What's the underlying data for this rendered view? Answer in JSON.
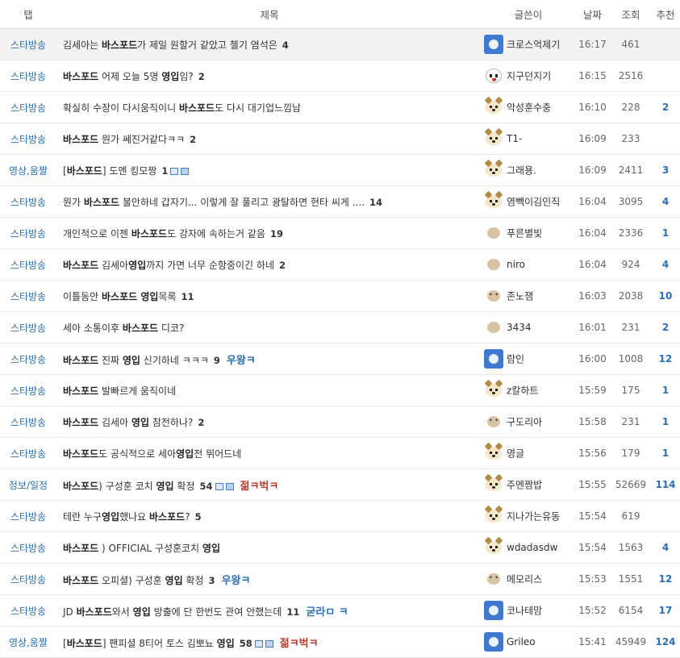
{
  "header": {
    "tab": "탭",
    "title": "제목",
    "writer": "글쓴이",
    "date": "날짜",
    "views": "조회",
    "recommend": "추천"
  },
  "rows": [
    {
      "tab": "스타방송",
      "title": [
        {
          "t": "김세아는 "
        },
        {
          "t": "바스포드",
          "b": true
        },
        {
          "t": "가 제일 원할거 같았고 첼기 염석은"
        }
      ],
      "comments": "4",
      "writer": "크로스억제기",
      "avatar": "blue",
      "date": "16:17",
      "views": "461",
      "rec": ""
    },
    {
      "tab": "스타방송",
      "title": [
        {
          "t": "바스포드",
          "b": true
        },
        {
          "t": " 어제 오늘 5명 "
        },
        {
          "t": "영입",
          "b": true
        },
        {
          "t": "임?"
        }
      ],
      "comments": "2",
      "writer": "지구던지기",
      "avatar": "panda",
      "date": "16:15",
      "views": "2516",
      "rec": ""
    },
    {
      "tab": "스타방송",
      "title": [
        {
          "t": "확실히 수장이 다시움직이니 "
        },
        {
          "t": "바스포드",
          "b": true
        },
        {
          "t": "도 다시 대기업느낌남"
        }
      ],
      "comments": "",
      "writer": "악성훈수충",
      "avatar": "dog",
      "date": "16:10",
      "views": "228",
      "rec": "2"
    },
    {
      "tab": "스타방송",
      "title": [
        {
          "t": "바스포드",
          "b": true
        },
        {
          "t": " 뭔가 쎄진거같다ㅋㅋ"
        }
      ],
      "comments": "2",
      "writer": "T1-",
      "avatar": "dog",
      "date": "16:09",
      "views": "233",
      "rec": ""
    },
    {
      "tab": "영상,움짤",
      "title": [
        {
          "t": "["
        },
        {
          "t": "바스포드",
          "b": true
        },
        {
          "t": "] 도멘 킹모짱"
        }
      ],
      "comments": "1",
      "attach": true,
      "writer": "그래용.",
      "avatar": "dog",
      "date": "16:09",
      "views": "2411",
      "rec": "3"
    },
    {
      "tab": "스타방송",
      "title": [
        {
          "t": "뭔가 "
        },
        {
          "t": "바스포드",
          "b": true
        },
        {
          "t": " 불안하네 갑자기... 이렇게 잘 풀리고 광탈하면 현타 씨게 ...."
        }
      ],
      "comments": "14",
      "writer": "염빽이김인직",
      "avatar": "dog",
      "date": "16:04",
      "views": "3095",
      "rec": "4"
    },
    {
      "tab": "스타방송",
      "title": [
        {
          "t": "개인적으로 이젠 "
        },
        {
          "t": "바스포드",
          "b": true
        },
        {
          "t": "도 강자에 속하는거 같음"
        }
      ],
      "comments": "19",
      "writer": "푸른별빛",
      "avatar": "ball",
      "date": "16:04",
      "views": "2336",
      "rec": "1"
    },
    {
      "tab": "스타방송",
      "title": [
        {
          "t": "바스포드",
          "b": true
        },
        {
          "t": " 김세아"
        },
        {
          "t": "영입",
          "b": true
        },
        {
          "t": "까지 가면 너무 순항중이긴 하네"
        }
      ],
      "comments": "2",
      "writer": "niro",
      "avatar": "ball",
      "date": "16:04",
      "views": "924",
      "rec": "4"
    },
    {
      "tab": "스타방송",
      "title": [
        {
          "t": "이틀동안 "
        },
        {
          "t": "바스포드 영입",
          "b": true
        },
        {
          "t": "목록"
        }
      ],
      "comments": "11",
      "writer": "존노잼",
      "avatar": "balldots",
      "date": "16:03",
      "views": "2038",
      "rec": "10"
    },
    {
      "tab": "스타방송",
      "title": [
        {
          "t": "세아 소통이후 "
        },
        {
          "t": "바스포드",
          "b": true
        },
        {
          "t": " 디코?"
        }
      ],
      "comments": "",
      "writer": "3434",
      "avatar": "ball",
      "date": "16:01",
      "views": "231",
      "rec": "2"
    },
    {
      "tab": "스타방송",
      "title": [
        {
          "t": "바스포드",
          "b": true
        },
        {
          "t": " 진짜 "
        },
        {
          "t": "영입",
          "b": true
        },
        {
          "t": " 신기하네 ㅋㅋㅋ"
        }
      ],
      "comments": "9",
      "badge": {
        "text": "우왕ㅋ",
        "color": "blue"
      },
      "writer": "람인",
      "avatar": "blue",
      "date": "16:00",
      "views": "1008",
      "rec": "12"
    },
    {
      "tab": "스타방송",
      "title": [
        {
          "t": "바스포드",
          "b": true
        },
        {
          "t": " 발빠르게 움직이네"
        }
      ],
      "comments": "",
      "writer": "z칼하트",
      "avatar": "dog",
      "date": "15:59",
      "views": "175",
      "rec": "1"
    },
    {
      "tab": "스타방송",
      "title": [
        {
          "t": "바스포드",
          "b": true
        },
        {
          "t": " 김세아 "
        },
        {
          "t": "영입",
          "b": true
        },
        {
          "t": " 참전하나?"
        }
      ],
      "comments": "2",
      "writer": "구도리아",
      "avatar": "balldots",
      "date": "15:58",
      "views": "231",
      "rec": "1"
    },
    {
      "tab": "스타방송",
      "title": [
        {
          "t": "바스포드",
          "b": true
        },
        {
          "t": "도 공식적으로 세아"
        },
        {
          "t": "영입",
          "b": true
        },
        {
          "t": "전 뛰어드네"
        }
      ],
      "comments": "",
      "writer": "영글",
      "avatar": "dog",
      "date": "15:56",
      "views": "179",
      "rec": "1"
    },
    {
      "tab": "정보/일정",
      "title": [
        {
          "t": "바스포드",
          "b": true
        },
        {
          "t": ") 구성훈 코치 "
        },
        {
          "t": "영입",
          "b": true
        },
        {
          "t": " 확정"
        }
      ],
      "comments": "54",
      "attach": true,
      "badge": {
        "text": "젊ㅋ벅ㅋ",
        "color": "red"
      },
      "writer": "주멘짬밥",
      "avatar": "dog",
      "date": "15:55",
      "views": "52669",
      "rec": "114"
    },
    {
      "tab": "스타방송",
      "title": [
        {
          "t": "테란 누구"
        },
        {
          "t": "영입",
          "b": true
        },
        {
          "t": "했나요 "
        },
        {
          "t": "바스포드",
          "b": true
        },
        {
          "t": "?"
        }
      ],
      "comments": "5",
      "writer": "지나가는유동",
      "avatar": "dog",
      "date": "15:54",
      "views": "619",
      "rec": ""
    },
    {
      "tab": "스타방송",
      "title": [
        {
          "t": "바스포드",
          "b": true
        },
        {
          "t": " ) OFFICIAL 구성훈코치 "
        },
        {
          "t": "영입",
          "b": true
        }
      ],
      "comments": "",
      "writer": "wdadasdw",
      "avatar": "dog",
      "date": "15:54",
      "views": "1563",
      "rec": "4"
    },
    {
      "tab": "스타방송",
      "title": [
        {
          "t": "바스포드",
          "b": true
        },
        {
          "t": " 오피셜) 구성훈 "
        },
        {
          "t": "영입",
          "b": true
        },
        {
          "t": " 확정"
        }
      ],
      "comments": "3",
      "badge": {
        "text": "우왕ㅋ",
        "color": "blue"
      },
      "writer": "메모리스",
      "avatar": "balldots",
      "date": "15:53",
      "views": "1551",
      "rec": "12"
    },
    {
      "tab": "스타방송",
      "title": [
        {
          "t": "JD "
        },
        {
          "t": "바스포드",
          "b": true
        },
        {
          "t": "와서 "
        },
        {
          "t": "영입",
          "b": true
        },
        {
          "t": " 방출에 단 한번도 관여 안했는데"
        }
      ],
      "comments": "11",
      "badge": {
        "text": "굳라ㅁ ㅋ",
        "color": "blue"
      },
      "writer": "코나테맘",
      "avatar": "blue",
      "date": "15:52",
      "views": "6154",
      "rec": "17"
    },
    {
      "tab": "영상,움짤",
      "title": [
        {
          "t": "["
        },
        {
          "t": "바스포드",
          "b": true
        },
        {
          "t": "] 팬피셜 8티어 토스 김뽀뇨 "
        },
        {
          "t": "영입",
          "b": true
        }
      ],
      "comments": "58",
      "attach": true,
      "badge": {
        "text": "젊ㅋ벅ㅋ",
        "color": "red"
      },
      "writer": "Grileo",
      "avatar": "blue",
      "date": "15:41",
      "views": "45949",
      "rec": "124"
    }
  ]
}
